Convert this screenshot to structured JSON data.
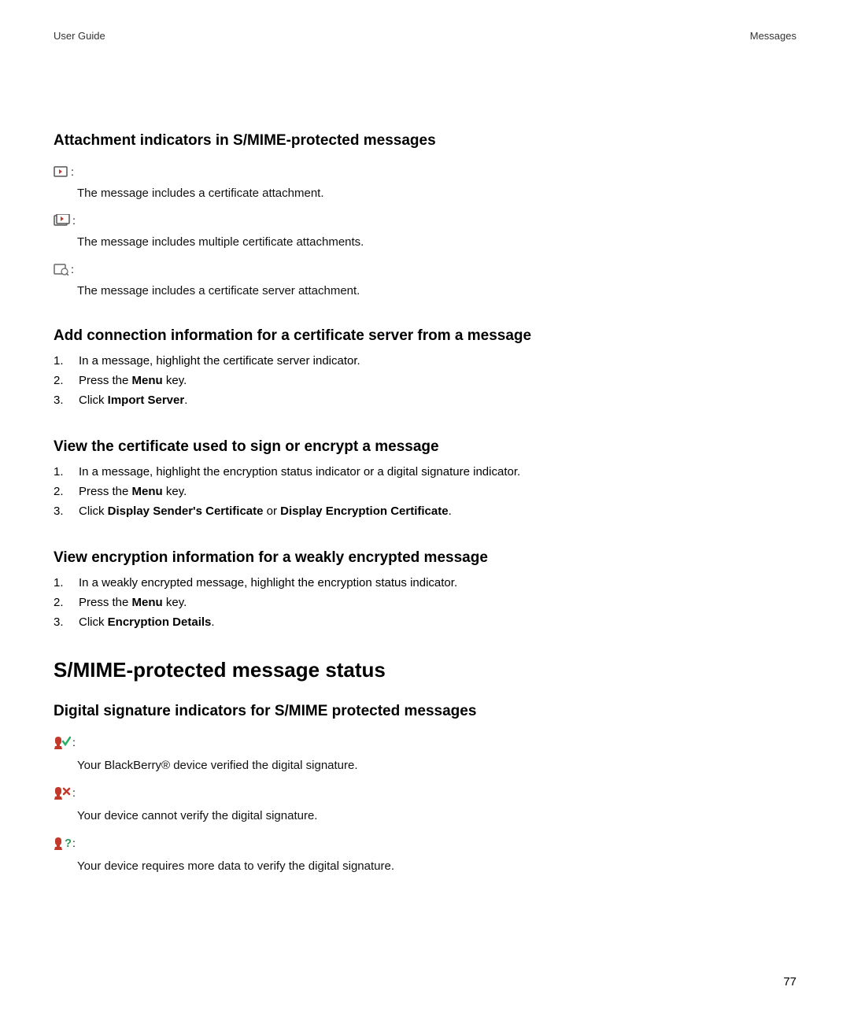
{
  "header": {
    "left": "User Guide",
    "right": "Messages"
  },
  "sec1": {
    "title": "Attachment indicators in S/MIME-protected messages",
    "items": [
      {
        "desc": "The message includes a certificate attachment."
      },
      {
        "desc": "The message includes multiple certificate attachments."
      },
      {
        "desc": "The message includes a certificate server attachment."
      }
    ]
  },
  "sec2": {
    "title": "Add connection information for a certificate server from a message",
    "step1": "In a message, highlight the certificate server indicator.",
    "step2a": "Press the ",
    "step2b": "Menu",
    "step2c": " key.",
    "step3a": "Click ",
    "step3b": "Import Server",
    "step3c": "."
  },
  "sec3": {
    "title": "View the certificate used to sign or encrypt a message",
    "step1": "In a message, highlight the encryption status indicator or a digital signature indicator.",
    "step2a": "Press the ",
    "step2b": "Menu",
    "step2c": " key.",
    "step3a": "Click ",
    "step3b": "Display Sender's Certificate",
    "step3c": " or ",
    "step3d": "Display Encryption Certificate",
    "step3e": "."
  },
  "sec4": {
    "title": "View encryption information for a weakly encrypted message",
    "step1": "In a weakly encrypted message, highlight the encryption status indicator.",
    "step2a": "Press the ",
    "step2b": "Menu",
    "step2c": " key.",
    "step3a": "Click ",
    "step3b": "Encryption Details",
    "step3c": "."
  },
  "mainh2": "S/MIME-protected message status",
  "sec5": {
    "title": "Digital signature indicators for S/MIME protected messages",
    "items": [
      {
        "desc": "Your BlackBerry® device verified the digital signature."
      },
      {
        "desc": "Your device cannot verify the digital signature."
      },
      {
        "desc": "Your device requires more data to verify the digital signature."
      }
    ]
  },
  "pagenum": "77"
}
